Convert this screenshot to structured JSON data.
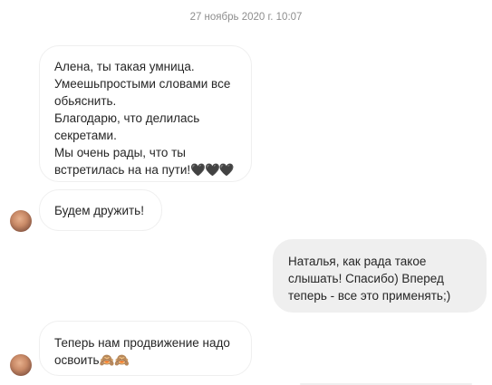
{
  "thread": {
    "timestamp": "27 ноябрь 2020 г. 10:07"
  },
  "messages": [
    {
      "direction": "incoming",
      "text": "Алена, ты такая умница.\nУмеешьпростыми словами все обьяснить.\nБлагодарю, что делилась секретами.\nМы очень рады, что ты встретилась на на пути!",
      "emoji": "🖤🖤🖤"
    },
    {
      "direction": "incoming",
      "text": "Будем дружить!"
    },
    {
      "direction": "outgoing",
      "text": "Наталья, как рада такое слышать! Спасибо) Вперед теперь - все это применять;)"
    },
    {
      "direction": "incoming",
      "text": "Теперь нам продвижение надо освоить🙈🙈"
    }
  ]
}
